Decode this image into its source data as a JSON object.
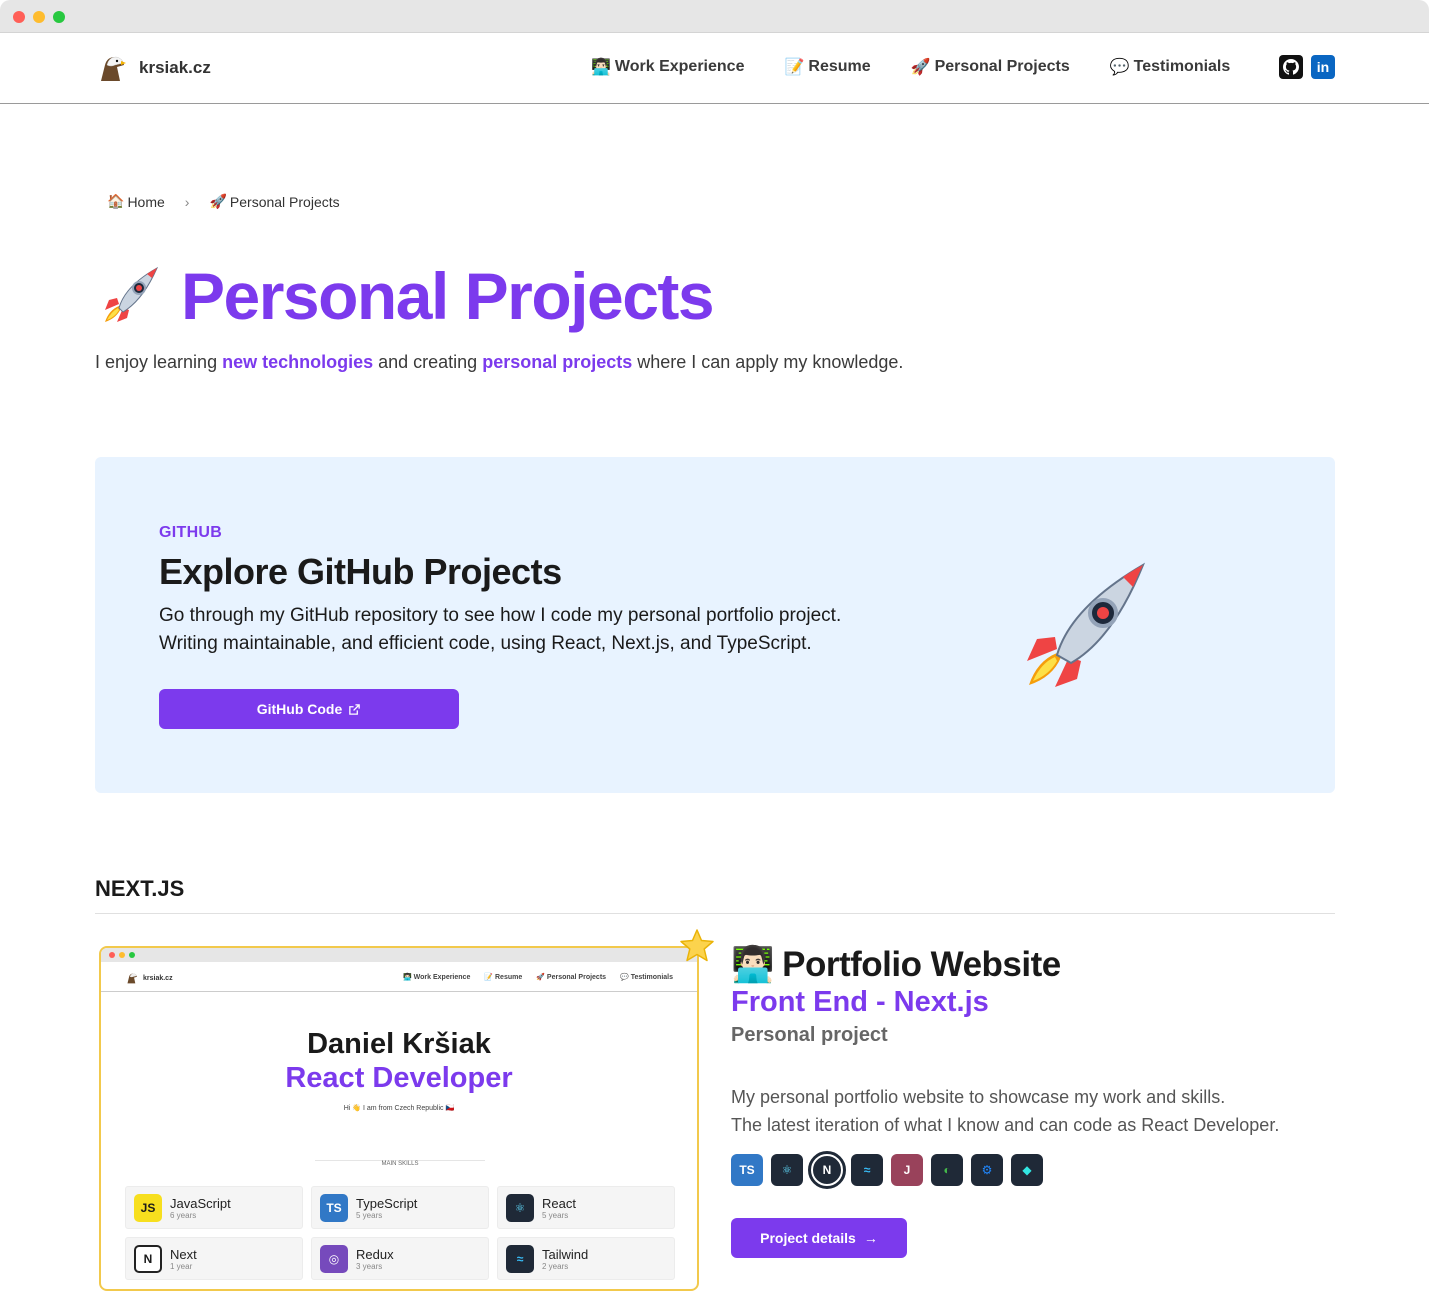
{
  "site": {
    "logo_text": "krsiak.cz",
    "logo_icon": "eagle-icon"
  },
  "nav": [
    {
      "emoji": "👨🏻‍💻",
      "label": "Work Experience"
    },
    {
      "emoji": "📝",
      "label": "Resume"
    },
    {
      "emoji": "🚀",
      "label": "Personal Projects"
    },
    {
      "emoji": "💬",
      "label": "Testimonials"
    }
  ],
  "social": {
    "github": "github-icon",
    "linkedin_label": "in"
  },
  "breadcrumb": [
    {
      "emoji": "🏠",
      "label": "Home"
    },
    {
      "emoji": "🚀",
      "label": "Personal Projects"
    }
  ],
  "breadcrumb_sep": "›",
  "page": {
    "title_emoji": "rocket-icon",
    "title": "Personal Projects",
    "intro_1": "I enjoy learning ",
    "intro_hl1": "new technologies",
    "intro_2": " and creating ",
    "intro_hl2": "personal projects",
    "intro_3": " where I can apply my knowledge."
  },
  "github_card": {
    "kicker": "GITHUB",
    "title": "Explore GitHub Projects",
    "desc_line1": "Go through my GitHub repository to see how I code my personal portfolio project.",
    "desc_line2": "Writing maintainable, and efficient code, using React, Next.js, and TypeScript.",
    "button": "GitHub Code",
    "bg_color": "#e8f3ff"
  },
  "section": {
    "title": "NEXT.JS"
  },
  "preview": {
    "logo": "krsiak.cz",
    "nav": [
      "👨🏻‍💻 Work Experience",
      "📝 Resume",
      "🚀 Personal Projects",
      "💬 Testimonials"
    ],
    "name": "Daniel Kršiak",
    "role": "React Developer",
    "hi": "Hi 👋 I am from Czech Republic 🇨🇿",
    "skills_label": "MAIN SKILLS",
    "skills": [
      {
        "name": "JavaScript",
        "years": "6 years",
        "icon": "JS",
        "bg": "#f7df1e",
        "fg": "#1a1a1a"
      },
      {
        "name": "TypeScript",
        "years": "5 years",
        "icon": "TS",
        "bg": "#3178c6",
        "fg": "#ffffff"
      },
      {
        "name": "React",
        "years": "5 years",
        "icon": "⚛",
        "bg": "#1f2937",
        "fg": "#61dafb"
      },
      {
        "name": "Next",
        "years": "1 year",
        "icon": "N",
        "bg": "#ffffff",
        "fg": "#1a1a1a"
      },
      {
        "name": "Redux",
        "years": "3 years",
        "icon": "◎",
        "bg": "#764abc",
        "fg": "#ffffff"
      },
      {
        "name": "Tailwind",
        "years": "2 years",
        "icon": "≈",
        "bg": "#1f2937",
        "fg": "#38bdf8"
      }
    ]
  },
  "project": {
    "emoji": "👨🏻‍💻",
    "title": "Portfolio Website",
    "subtitle": "Front End - Next.js",
    "type": "Personal project",
    "desc_line1": "My personal portfolio website to showcase my work and skills.",
    "desc_line2": "The latest iteration of what I know and can code as React Developer.",
    "tech": [
      {
        "icon": "typescript-icon",
        "label": "TS",
        "bg": "#3178c6",
        "fg": "#ffffff"
      },
      {
        "icon": "react-icon",
        "label": "⚛",
        "bg": "#1f2937",
        "fg": "#61dafb"
      },
      {
        "icon": "nextjs-icon",
        "label": "N",
        "bg": "#1f2937",
        "fg": "#ffffff"
      },
      {
        "icon": "tailwind-icon",
        "label": "≈",
        "bg": "#1f2937",
        "fg": "#38bdf8"
      },
      {
        "icon": "jest-icon",
        "label": "J",
        "bg": "#99425b",
        "fg": "#ffffff"
      },
      {
        "icon": "playwright-icon",
        "label": "◐",
        "bg": "#1f2937",
        "fg": "#45ba4b"
      },
      {
        "icon": "github-actions-icon",
        "label": "⚙",
        "bg": "#1f2937",
        "fg": "#2088ff"
      },
      {
        "icon": "netlify-icon",
        "label": "◆",
        "bg": "#1f2937",
        "fg": "#32e6e2"
      }
    ],
    "button": "Project details",
    "button_arrow": "→"
  },
  "colors": {
    "accent": "#7c3aed",
    "star": "#f2c94c"
  }
}
